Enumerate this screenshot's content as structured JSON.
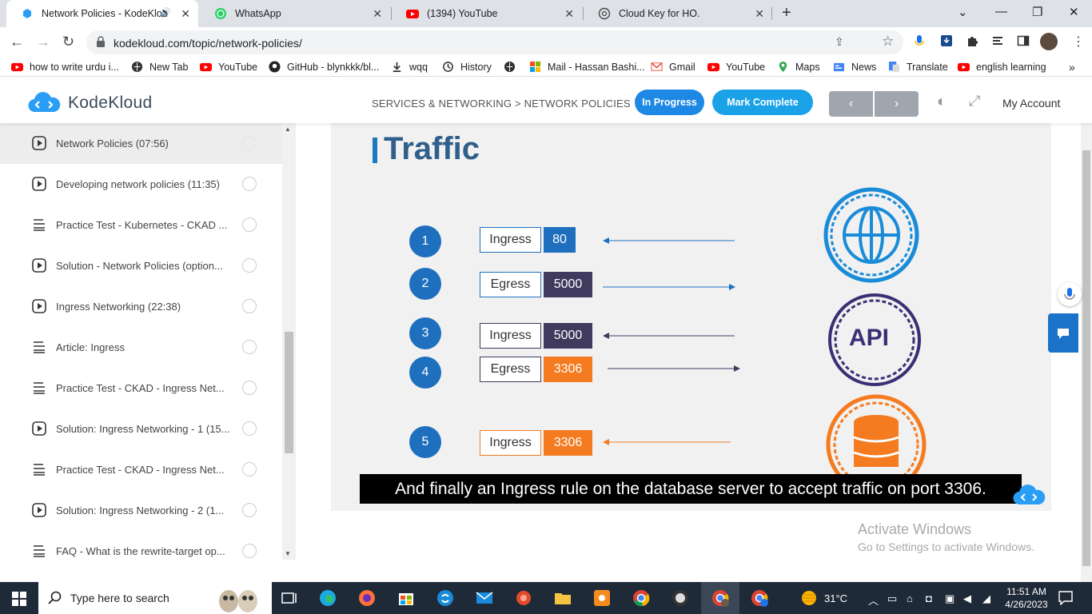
{
  "browser": {
    "tabs": [
      {
        "title": "Network Policies - KodeKlou",
        "active": true
      },
      {
        "title": "WhatsApp",
        "active": false
      },
      {
        "title": "(1394) YouTube",
        "active": false
      },
      {
        "title": "Cloud Key for HO.",
        "active": false
      }
    ],
    "url": "kodekloud.com/topic/network-policies/",
    "bookmarks": [
      {
        "label": "how to write urdu i...",
        "icon": "youtube-icon"
      },
      {
        "label": "New Tab",
        "icon": "globe-icon"
      },
      {
        "label": "YouTube",
        "icon": "youtube-icon"
      },
      {
        "label": "GitHub - blynkkk/bl...",
        "icon": "github-icon"
      },
      {
        "label": "wqq",
        "icon": "download-icon"
      },
      {
        "label": "History",
        "icon": "history-icon"
      },
      {
        "label": "",
        "icon": "globe-icon"
      },
      {
        "label": "Mail - Hassan Bashi...",
        "icon": "microsoft-icon"
      },
      {
        "label": "Gmail",
        "icon": "gmail-icon"
      },
      {
        "label": "YouTube",
        "icon": "youtube-icon"
      },
      {
        "label": "Maps",
        "icon": "maps-icon"
      },
      {
        "label": "News",
        "icon": "news-icon"
      },
      {
        "label": "Translate",
        "icon": "translate-icon"
      },
      {
        "label": "english learning",
        "icon": "youtube-icon"
      }
    ]
  },
  "header": {
    "brand": "KodeKloud",
    "breadcrumb": "SERVICES & NETWORKING > NETWORK POLICIES",
    "status_button": "In Progress",
    "complete_button": "Mark Complete",
    "prev_label": "‹",
    "next_label": "›",
    "account_label": "My Account"
  },
  "sidebar": {
    "items": [
      {
        "label": "Network Policies (07:56)",
        "icon": "play-icon",
        "selected": true
      },
      {
        "label": "Developing network policies (11:35)",
        "icon": "play-icon",
        "selected": false
      },
      {
        "label": "Practice Test - Kubernetes - CKAD ...",
        "icon": "lab-icon",
        "selected": false
      },
      {
        "label": "Solution - Network Policies (option...",
        "icon": "play-icon",
        "selected": false
      },
      {
        "label": "Ingress Networking (22:38)",
        "icon": "play-icon",
        "selected": false
      },
      {
        "label": "Article: Ingress",
        "icon": "lab-icon",
        "selected": false
      },
      {
        "label": "Practice Test - CKAD - Ingress Net...",
        "icon": "lab-icon",
        "selected": false
      },
      {
        "label": "Solution: Ingress Networking - 1 (15...",
        "icon": "play-icon",
        "selected": false
      },
      {
        "label": "Practice Test - CKAD - Ingress Net...",
        "icon": "lab-icon",
        "selected": false
      },
      {
        "label": "Solution: Ingress Networking - 2 (1...",
        "icon": "play-icon",
        "selected": false
      },
      {
        "label": "FAQ - What is the rewrite-target op...",
        "icon": "lab-icon",
        "selected": false
      }
    ]
  },
  "slide": {
    "title": "Traffic",
    "rules": [
      {
        "num": "1",
        "direction": "Ingress",
        "port": "80",
        "color": "#1f6fbf",
        "arrow": "in",
        "arrow_color": "#1f6fbf"
      },
      {
        "num": "2",
        "direction": "Egress",
        "port": "5000",
        "color": "#3f3a5e",
        "arrow": "out",
        "arrow_color": "#1f6fbf"
      },
      {
        "num": "3",
        "direction": "Ingress",
        "port": "5000",
        "color": "#3f3a5e",
        "arrow": "in",
        "arrow_color": "#3f3a5e"
      },
      {
        "num": "4",
        "direction": "Egress",
        "port": "3306",
        "color": "#f47b20",
        "arrow": "out",
        "arrow_color": "#3f3a5e"
      },
      {
        "num": "5",
        "direction": "Ingress",
        "port": "3306",
        "color": "#f47b20",
        "arrow": "in",
        "arrow_color": "#f47b20"
      }
    ],
    "api_label": "API",
    "caption": "And finally an Ingress rule on the database server to accept traffic on port 3306."
  },
  "watermark": {
    "line1": "Activate Windows",
    "line2": "Go to Settings to activate Windows."
  },
  "taskbar": {
    "search_placeholder": "Type here to search",
    "temperature": "31°C",
    "time": "11:51 AM",
    "date": "4/26/2023"
  },
  "colors": {
    "accent": "#1e88e5",
    "brand_blue": "#1f6fbf",
    "dark_port": "#3f3a5e",
    "orange_port": "#f47b20"
  }
}
